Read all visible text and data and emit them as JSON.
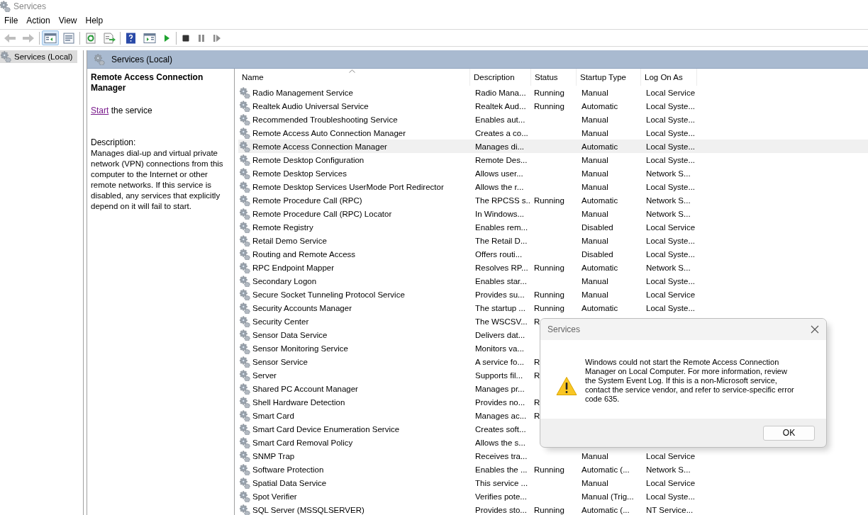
{
  "window": {
    "title": "Services"
  },
  "menu": [
    "File",
    "Action",
    "View",
    "Help"
  ],
  "toolbar": [
    {
      "kind": "back",
      "disabled": true,
      "pressed": false
    },
    {
      "kind": "forward",
      "disabled": true,
      "pressed": false
    },
    {
      "kind": "console-tree",
      "disabled": false,
      "pressed": true
    },
    {
      "kind": "properties",
      "disabled": false,
      "pressed": false
    },
    {
      "kind": "refresh",
      "disabled": false,
      "pressed": false
    },
    {
      "kind": "export",
      "disabled": false,
      "pressed": false
    },
    {
      "kind": "help",
      "disabled": false,
      "pressed": false
    },
    {
      "kind": "action-pane",
      "disabled": false,
      "pressed": false
    },
    {
      "kind": "start",
      "disabled": false,
      "pressed": false
    },
    {
      "kind": "stop",
      "disabled": false,
      "pressed": false
    },
    {
      "kind": "pause",
      "disabled": true,
      "pressed": false
    },
    {
      "kind": "resume",
      "disabled": true,
      "pressed": false
    }
  ],
  "tree": {
    "items": [
      {
        "label": "Services (Local)",
        "selected": true
      }
    ]
  },
  "pane_header": "Services (Local)",
  "details": {
    "title": "Remote Access Connection Manager",
    "action_link": "Start",
    "action_text": "the service",
    "description_label": "Description:",
    "description": "Manages dial-up and virtual private network (VPN) connections from this computer to the Internet or other remote networks. If this service is disabled, any services that explicitly depend on it will fail to start."
  },
  "table": {
    "columns": [
      {
        "label": "Name",
        "sorted": true
      },
      {
        "label": "Description",
        "sorted": false
      },
      {
        "label": "Status",
        "sorted": false
      },
      {
        "label": "Startup Type",
        "sorted": false
      },
      {
        "label": "Log On As",
        "sorted": false
      }
    ],
    "rows": [
      {
        "name": "Radio Management Service",
        "description": "Radio Mana...",
        "status": "Running",
        "startup": "Manual",
        "logon": "Local Service",
        "selected": false
      },
      {
        "name": "Realtek Audio Universal Service",
        "description": "Realtek Aud...",
        "status": "Running",
        "startup": "Automatic",
        "logon": "Local Syste...",
        "selected": false
      },
      {
        "name": "Recommended Troubleshooting Service",
        "description": "Enables aut...",
        "startup": "Manual",
        "logon": "Local Syste...",
        "selected": false
      },
      {
        "name": "Remote Access Auto Connection Manager",
        "description": "Creates a co...",
        "startup": "Manual",
        "logon": "Local Syste...",
        "selected": false
      },
      {
        "name": "Remote Access Connection Manager",
        "description": "Manages di...",
        "startup": "Automatic",
        "logon": "Local Syste...",
        "selected": true
      },
      {
        "name": "Remote Desktop Configuration",
        "description": "Remote Des...",
        "startup": "Manual",
        "logon": "Local Syste...",
        "selected": false
      },
      {
        "name": "Remote Desktop Services",
        "description": "Allows user...",
        "startup": "Manual",
        "logon": "Network S...",
        "selected": false
      },
      {
        "name": "Remote Desktop Services UserMode Port Redirector",
        "description": "Allows the r...",
        "startup": "Manual",
        "logon": "Local Syste...",
        "selected": false
      },
      {
        "name": "Remote Procedure Call (RPC)",
        "description": "The RPCSS s...",
        "status": "Running",
        "startup": "Automatic",
        "logon": "Network S...",
        "selected": false
      },
      {
        "name": "Remote Procedure Call (RPC) Locator",
        "description": "In Windows...",
        "startup": "Manual",
        "logon": "Network S...",
        "selected": false
      },
      {
        "name": "Remote Registry",
        "description": "Enables rem...",
        "startup": "Disabled",
        "logon": "Local Service",
        "selected": false
      },
      {
        "name": "Retail Demo Service",
        "description": "The Retail D...",
        "startup": "Manual",
        "logon": "Local Syste...",
        "selected": false
      },
      {
        "name": "Routing and Remote Access",
        "description": "Offers routi...",
        "startup": "Disabled",
        "logon": "Local Syste...",
        "selected": false
      },
      {
        "name": "RPC Endpoint Mapper",
        "description": "Resolves RP...",
        "status": "Running",
        "startup": "Automatic",
        "logon": "Network S...",
        "selected": false
      },
      {
        "name": "Secondary Logon",
        "description": "Enables star...",
        "startup": "Manual",
        "logon": "Local Syste...",
        "selected": false
      },
      {
        "name": "Secure Socket Tunneling Protocol Service",
        "description": "Provides su...",
        "status": "Running",
        "startup": "Manual",
        "logon": "Local Service",
        "selected": false
      },
      {
        "name": "Security Accounts Manager",
        "description": "The startup ...",
        "status": "Running",
        "startup": "Automatic",
        "logon": "Local Syste...",
        "selected": false
      },
      {
        "name": "Security Center",
        "description": "The WSCSV...",
        "status": "R",
        "selected": false
      },
      {
        "name": "Sensor Data Service",
        "description": "Delivers dat...",
        "selected": false
      },
      {
        "name": "Sensor Monitoring Service",
        "description": "Monitors va...",
        "selected": false
      },
      {
        "name": "Sensor Service",
        "description": "A service fo...",
        "status": "R",
        "selected": false
      },
      {
        "name": "Server",
        "description": "Supports fil...",
        "status": "R",
        "selected": false
      },
      {
        "name": "Shared PC Account Manager",
        "description": "Manages pr...",
        "selected": false
      },
      {
        "name": "Shell Hardware Detection",
        "description": "Provides no...",
        "status": "R",
        "selected": false
      },
      {
        "name": "Smart Card",
        "description": "Manages ac...",
        "status": "R",
        "selected": false
      },
      {
        "name": "Smart Card Device Enumeration Service",
        "description": "Creates soft...",
        "selected": false
      },
      {
        "name": "Smart Card Removal Policy",
        "description": "Allows the s...",
        "selected": false
      },
      {
        "name": "SNMP Trap",
        "description": "Receives tra...",
        "startup": "Manual",
        "logon": "Local Service",
        "selected": false
      },
      {
        "name": "Software Protection",
        "description": "Enables the ...",
        "status": "Running",
        "startup": "Automatic (...",
        "logon": "Network S...",
        "selected": false
      },
      {
        "name": "Spatial Data Service",
        "description": "This service ...",
        "startup": "Manual",
        "logon": "Local Service",
        "selected": false
      },
      {
        "name": "Spot Verifier",
        "description": "Verifies pote...",
        "startup": "Manual (Trig...",
        "logon": "Local Syste...",
        "selected": false
      },
      {
        "name": "SQL Server (MSSQLSERVER)",
        "description": "Provides sto...",
        "status": "Running",
        "startup": "Automatic (...",
        "logon": "NT Service...",
        "selected": false
      }
    ]
  },
  "dialog": {
    "title": "Services",
    "message": "Windows could not start the Remote Access Connection Manager on Local Computer. For more information, review the System Event Log. If this is a non-Microsoft service, contact the service vendor, and refer to service-specific error code 635.",
    "buttons": [
      "OK"
    ]
  }
}
